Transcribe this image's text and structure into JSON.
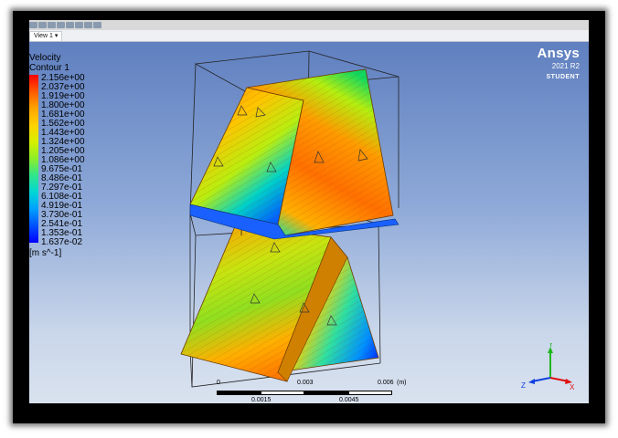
{
  "toolbar": {
    "icons": [
      "select-icon",
      "rotate-icon",
      "pan-icon",
      "zoom-in-icon",
      "zoom-out-icon",
      "zoom-box-icon",
      "fit-icon",
      "view-icon"
    ]
  },
  "tabs": [
    {
      "label": "View 1",
      "dropdown_icon": "chevron-down-icon"
    }
  ],
  "legend": {
    "title": "Velocity",
    "subtitle": "Contour 1",
    "levels": [
      "2.156e+00",
      "2.037e+00",
      "1.919e+00",
      "1.800e+00",
      "1.681e+00",
      "1.562e+00",
      "1.443e+00",
      "1.324e+00",
      "1.205e+00",
      "1.086e+00",
      "9.675e-01",
      "8.486e-01",
      "7.297e-01",
      "6.108e-01",
      "4.919e-01",
      "3.730e-01",
      "2.541e-01",
      "1.353e-01",
      "1.637e-02"
    ],
    "units": "[m s^-1]"
  },
  "brand": {
    "name": "Ansys",
    "version": "2021 R2",
    "edition": "STUDENT"
  },
  "scale_bar": {
    "top_labels": [
      "0",
      "0.003",
      "0.006",
      "(m)"
    ],
    "bottom_labels": [
      "0.0015",
      "0.0045"
    ]
  },
  "triad": {
    "x": "X",
    "y": "Y",
    "z": "Z"
  },
  "colors": {
    "max": "#ff0000",
    "mid": "#8cee2a",
    "min": "#0000ff",
    "background_top": "#5f7fbf",
    "background_bottom": "#d9e2ef"
  }
}
